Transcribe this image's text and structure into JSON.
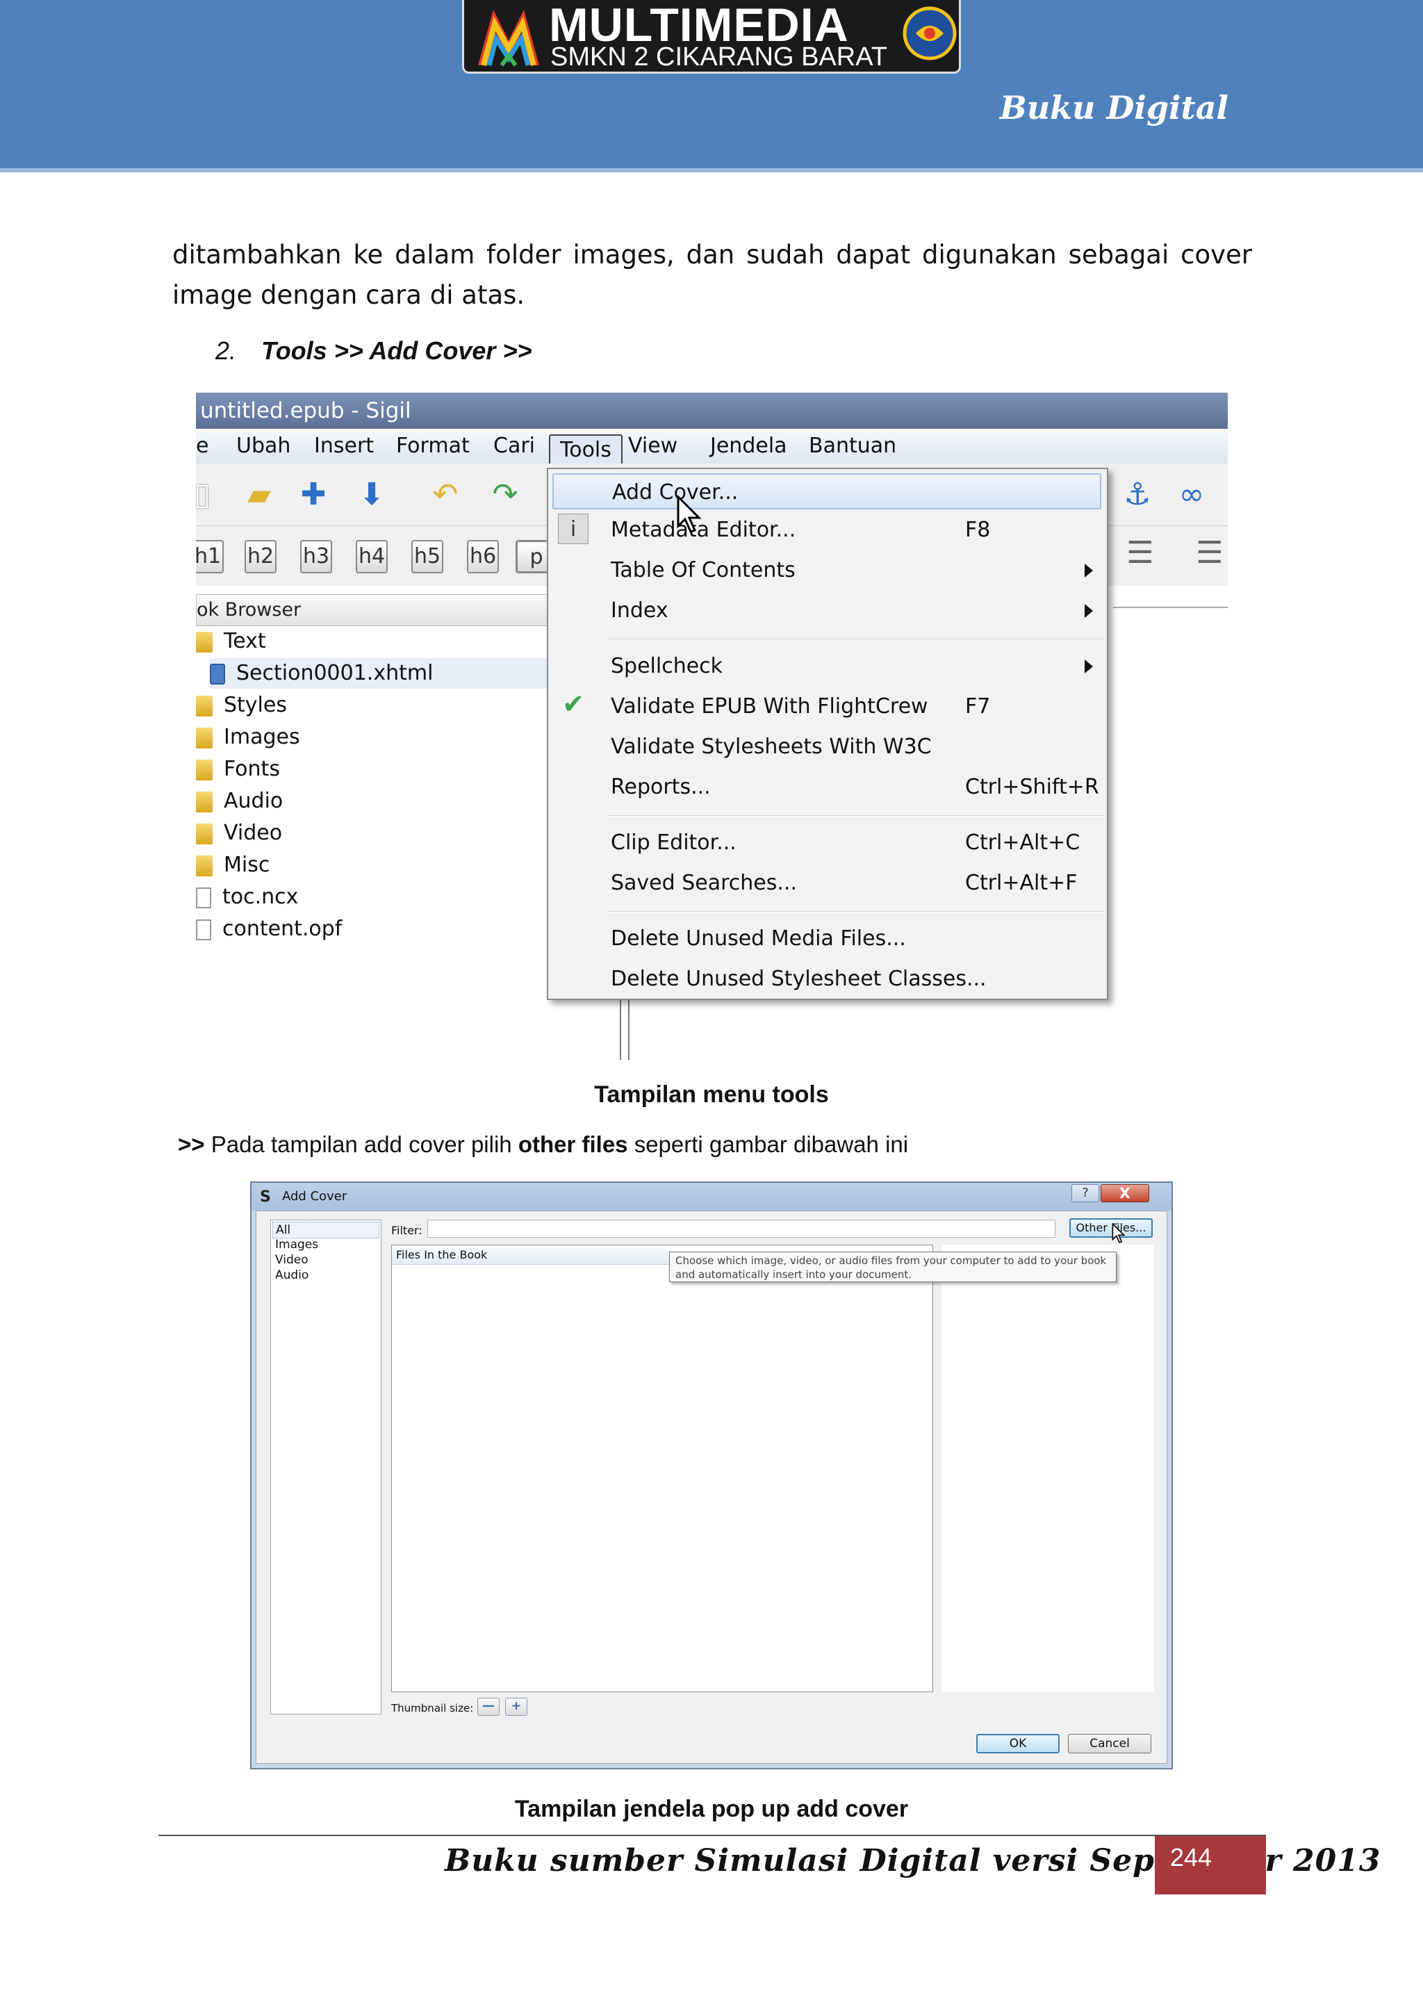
{
  "header": {
    "logo_title": "MULTIMEDIA",
    "logo_subtitle": "SMKN 2 CIKARANG BARAT",
    "tag": "Buku Digital",
    "colors": {
      "band": "#4f81bd",
      "logo_bg": "#1a1a1a"
    }
  },
  "body": {
    "paragraph": "ditambahkan ke dalam folder images, dan sudah dapat digunakan sebagai cover image dengan cara di atas.",
    "step_number": "2.",
    "step_text": "Tools >> Add Cover >>"
  },
  "screenshot_tools": {
    "window_title": "untitled.epub - Sigil",
    "menubar": [
      "e",
      "Ubah",
      "Insert",
      "Format",
      "Cari",
      "Tools",
      "View",
      "Jendela",
      "Bantuan"
    ],
    "heading_buttons": [
      "h1",
      "h2",
      "h3",
      "h4",
      "h5",
      "h6",
      "p"
    ],
    "panel_title": "ok Browser",
    "tree": [
      {
        "label": "Text",
        "kind": "folder"
      },
      {
        "label": "Section0001.xhtml",
        "kind": "xhtml"
      },
      {
        "label": "Styles",
        "kind": "folder"
      },
      {
        "label": "Images",
        "kind": "folder"
      },
      {
        "label": "Fonts",
        "kind": "folder"
      },
      {
        "label": "Audio",
        "kind": "folder"
      },
      {
        "label": "Video",
        "kind": "folder"
      },
      {
        "label": "Misc",
        "kind": "folder"
      },
      {
        "label": "toc.ncx",
        "kind": "file"
      },
      {
        "label": "content.opf",
        "kind": "file"
      }
    ],
    "menu_items": [
      {
        "label": "Add Cover...",
        "shortcut": "",
        "submenu": false,
        "icon": "",
        "highlighted": true
      },
      {
        "label": "Metadata Editor...",
        "shortcut": "F8",
        "submenu": false,
        "icon": "info-icon"
      },
      {
        "label": "Table Of Contents",
        "shortcut": "",
        "submenu": true,
        "icon": ""
      },
      {
        "label": "Index",
        "shortcut": "",
        "submenu": true,
        "icon": ""
      },
      {
        "label": "Spellcheck",
        "shortcut": "",
        "submenu": true,
        "icon": ""
      },
      {
        "label": "Validate EPUB With FlightCrew",
        "shortcut": "F7",
        "submenu": false,
        "icon": "checkmark-icon"
      },
      {
        "label": "Validate Stylesheets With W3C",
        "shortcut": "",
        "submenu": false,
        "icon": ""
      },
      {
        "label": "Reports...",
        "shortcut": "Ctrl+Shift+R",
        "submenu": false,
        "icon": ""
      },
      {
        "label": "Clip Editor...",
        "shortcut": "Ctrl+Alt+C",
        "submenu": false,
        "icon": ""
      },
      {
        "label": "Saved Searches...",
        "shortcut": "Ctrl+Alt+F",
        "submenu": false,
        "icon": ""
      },
      {
        "label": "Delete Unused Media Files...",
        "shortcut": "",
        "submenu": false,
        "icon": ""
      },
      {
        "label": "Delete Unused Stylesheet Classes...",
        "shortcut": "",
        "submenu": false,
        "icon": ""
      }
    ],
    "caption": "Tampilan menu tools"
  },
  "intro": {
    "prefix": ">>",
    "text_before": " Pada tampilan add cover pilih ",
    "bold": "other files",
    "text_after": " seperti gambar dibawah ini"
  },
  "screenshot_addcover": {
    "title": "Add Cover",
    "help_label": "?",
    "close_label": "X",
    "categories": [
      "All",
      "Images",
      "Video",
      "Audio"
    ],
    "filter_label": "Filter:",
    "other_files_button": "Other Files...",
    "files_header": "Files In the Book",
    "tooltip": "Choose which image, video, or audio files from your computer to add to your book and automatically insert into your document.",
    "thumbnail_label": "Thumbnail size:",
    "minus_label": "—",
    "plus_label": "+",
    "ok_label": "OK",
    "cancel_label": "Cancel",
    "caption": "Tampilan jendela pop up add cover"
  },
  "footer": {
    "text": "Buku sumber Simulasi Digital versi September 2013",
    "page_number": "244",
    "page_box_color": "#a8383b"
  }
}
